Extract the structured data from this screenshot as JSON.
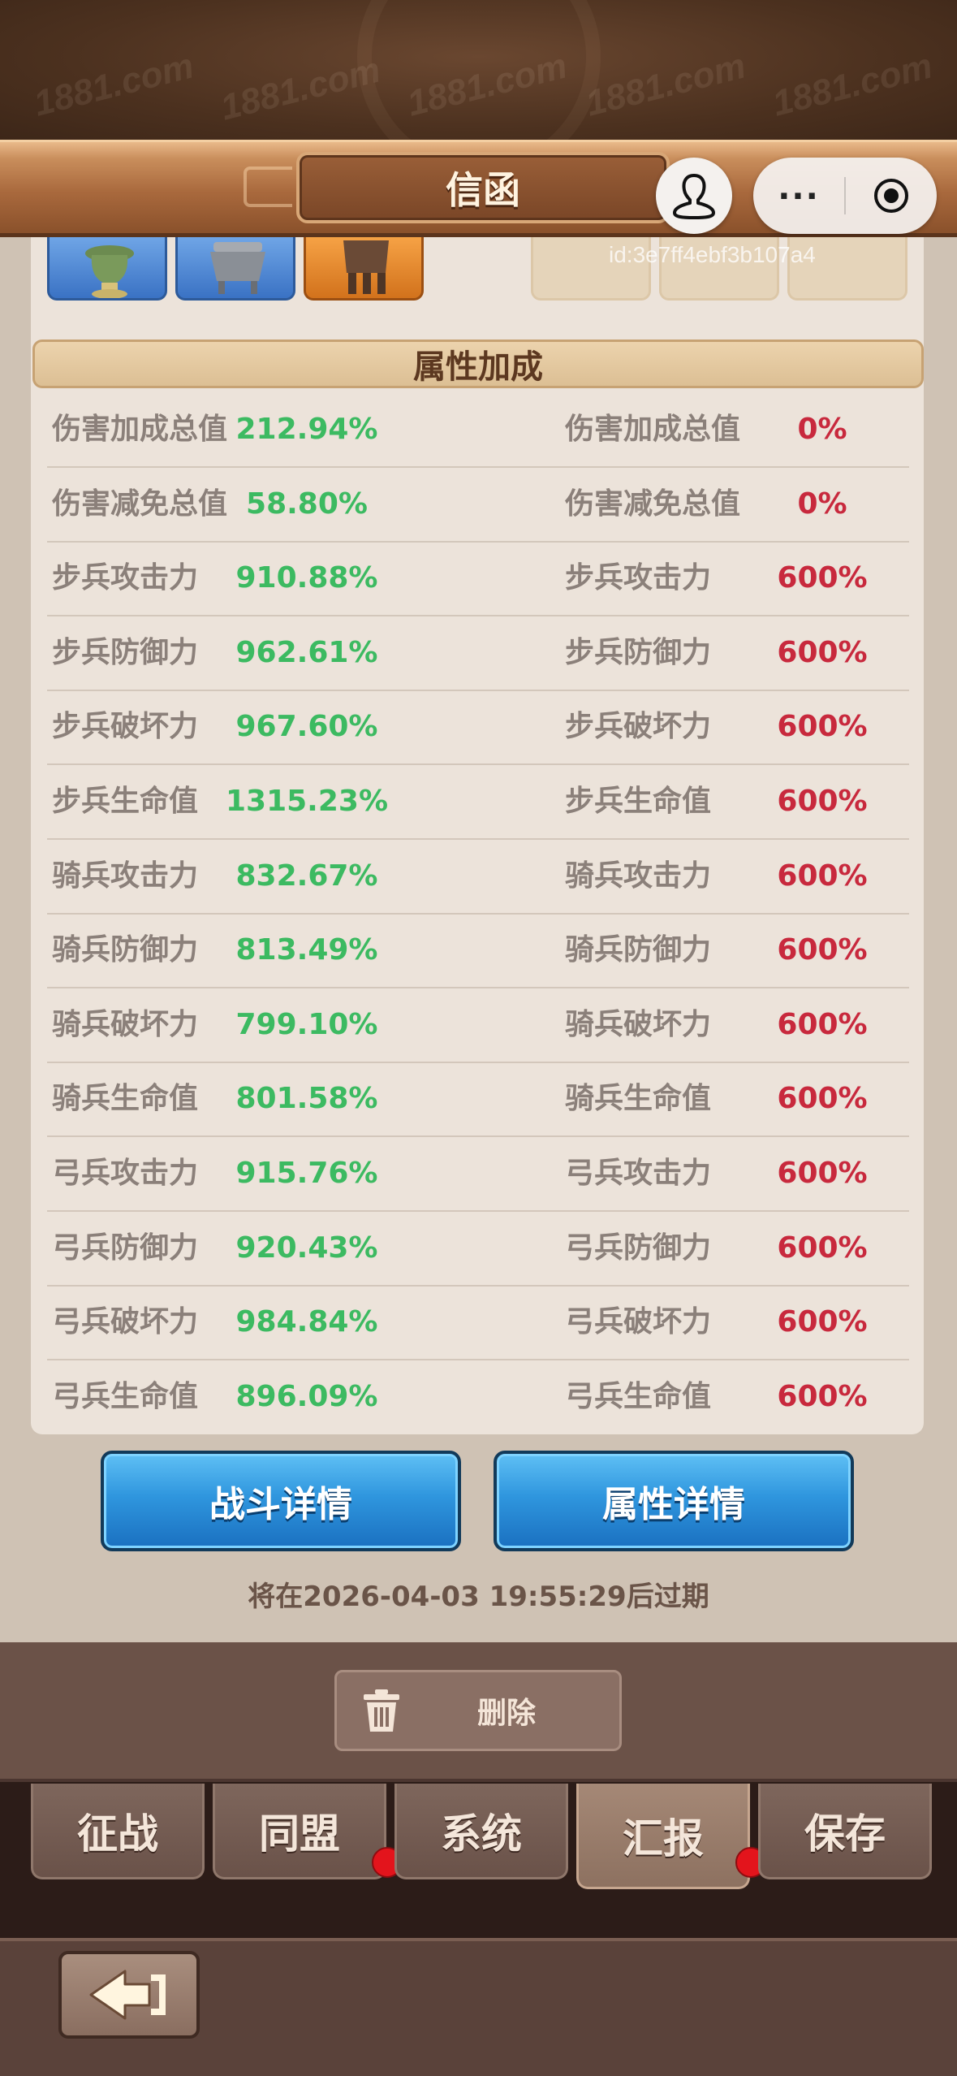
{
  "header": {
    "title": "信函",
    "watermark": "1881.com"
  },
  "mini_program": {
    "more_icon": "more-dots-icon",
    "close_icon": "target-icon",
    "avatar_icon": "user-silhouette-icon"
  },
  "info": {
    "id_text": "id:3e7ff4ebf3b107a4"
  },
  "section": {
    "title": "属性加成"
  },
  "attributes": [
    {
      "left_label": "伤害加成总值",
      "left_value": "212.94%",
      "right_label": "伤害加成总值",
      "right_value": "0%"
    },
    {
      "left_label": "伤害减免总值",
      "left_value": "58.80%",
      "right_label": "伤害减免总值",
      "right_value": "0%"
    },
    {
      "left_label": "步兵攻击力",
      "left_value": "910.88%",
      "right_label": "步兵攻击力",
      "right_value": "600%"
    },
    {
      "left_label": "步兵防御力",
      "left_value": "962.61%",
      "right_label": "步兵防御力",
      "right_value": "600%"
    },
    {
      "left_label": "步兵破坏力",
      "left_value": "967.60%",
      "right_label": "步兵破坏力",
      "right_value": "600%"
    },
    {
      "left_label": "步兵生命值",
      "left_value": "1315.23%",
      "right_label": "步兵生命值",
      "right_value": "600%"
    },
    {
      "left_label": "骑兵攻击力",
      "left_value": "832.67%",
      "right_label": "骑兵攻击力",
      "right_value": "600%"
    },
    {
      "left_label": "骑兵防御力",
      "left_value": "813.49%",
      "right_label": "骑兵防御力",
      "right_value": "600%"
    },
    {
      "left_label": "骑兵破坏力",
      "left_value": "799.10%",
      "right_label": "骑兵破坏力",
      "right_value": "600%"
    },
    {
      "left_label": "骑兵生命值",
      "left_value": "801.58%",
      "right_label": "骑兵生命值",
      "right_value": "600%"
    },
    {
      "left_label": "弓兵攻击力",
      "left_value": "915.76%",
      "right_label": "弓兵攻击力",
      "right_value": "600%"
    },
    {
      "left_label": "弓兵防御力",
      "left_value": "920.43%",
      "right_label": "弓兵防御力",
      "right_value": "600%"
    },
    {
      "left_label": "弓兵破坏力",
      "left_value": "984.84%",
      "right_label": "弓兵破坏力",
      "right_value": "600%"
    },
    {
      "left_label": "弓兵生命值",
      "left_value": "896.09%",
      "right_label": "弓兵生命值",
      "right_value": "600%"
    }
  ],
  "colors": {
    "positive_value": "#3cba61",
    "negative_value": "#c8293d",
    "label_gray": "#8b807a",
    "button_blue": "#2f96de",
    "notification_red": "#e3141c"
  },
  "buttons": {
    "battle_details": "战斗详情",
    "attribute_details": "属性详情"
  },
  "expire_text": "将在2026-04-03 19:55:29后过期",
  "delete_button": {
    "label": "删除",
    "icon": "trash-icon"
  },
  "tabs": [
    {
      "label": "征战",
      "active": false,
      "badge": false
    },
    {
      "label": "同盟",
      "active": false,
      "badge": true
    },
    {
      "label": "系统",
      "active": false,
      "badge": false
    },
    {
      "label": "汇报",
      "active": true,
      "badge": true
    },
    {
      "label": "保存",
      "active": false,
      "badge": false
    }
  ],
  "back_button": {
    "icon": "back-arrow-icon"
  }
}
